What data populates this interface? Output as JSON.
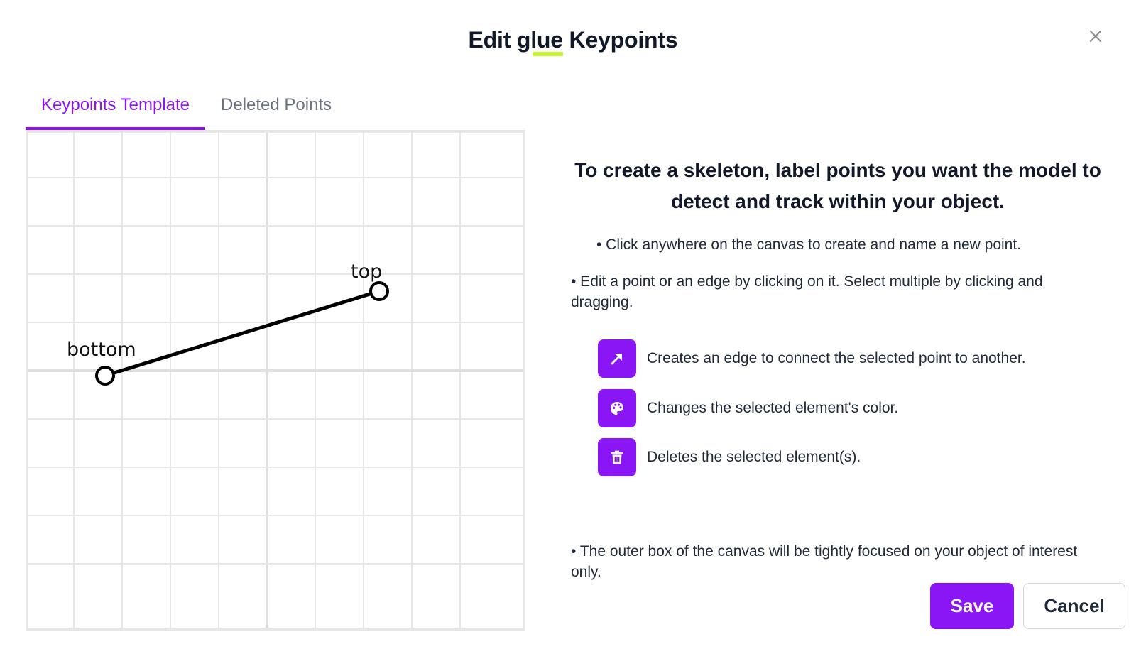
{
  "dialog": {
    "title_prefix": "Edit ",
    "title_highlight": "glue",
    "title_suffix": " Keypoints",
    "close_icon": "close-icon"
  },
  "tabs": [
    {
      "label": "Keypoints Template",
      "active": true
    },
    {
      "label": "Deleted Points",
      "active": false
    }
  ],
  "canvas": {
    "points": [
      {
        "label": "bottom"
      },
      {
        "label": "top"
      }
    ],
    "edges": [
      {
        "from": "bottom",
        "to": "top",
        "color": "#000000"
      }
    ]
  },
  "instructions": {
    "heading": "To create a skeleton, label points you want the model to detect and track within your object.",
    "bullet_click": "• Click anywhere on the canvas to create and name a new point.",
    "bullet_edit": "• Edit a point or an edge by clicking on it. Select multiple by clicking and dragging.",
    "bullet_outer": "• The outer box of the canvas will be tightly focused on your object of interest only.",
    "tools": [
      {
        "icon": "arrow-up-right-icon",
        "text": "Creates an edge to connect the selected point to another."
      },
      {
        "icon": "palette-icon",
        "text": "Changes the selected element's color."
      },
      {
        "icon": "trash-icon",
        "text": "Deletes the selected element(s)."
      }
    ]
  },
  "footer": {
    "save_label": "Save",
    "cancel_label": "Cancel"
  },
  "colors": {
    "accent": "#8a16f5",
    "highlight": "#c6f432",
    "grid": "#e6e6e6"
  }
}
